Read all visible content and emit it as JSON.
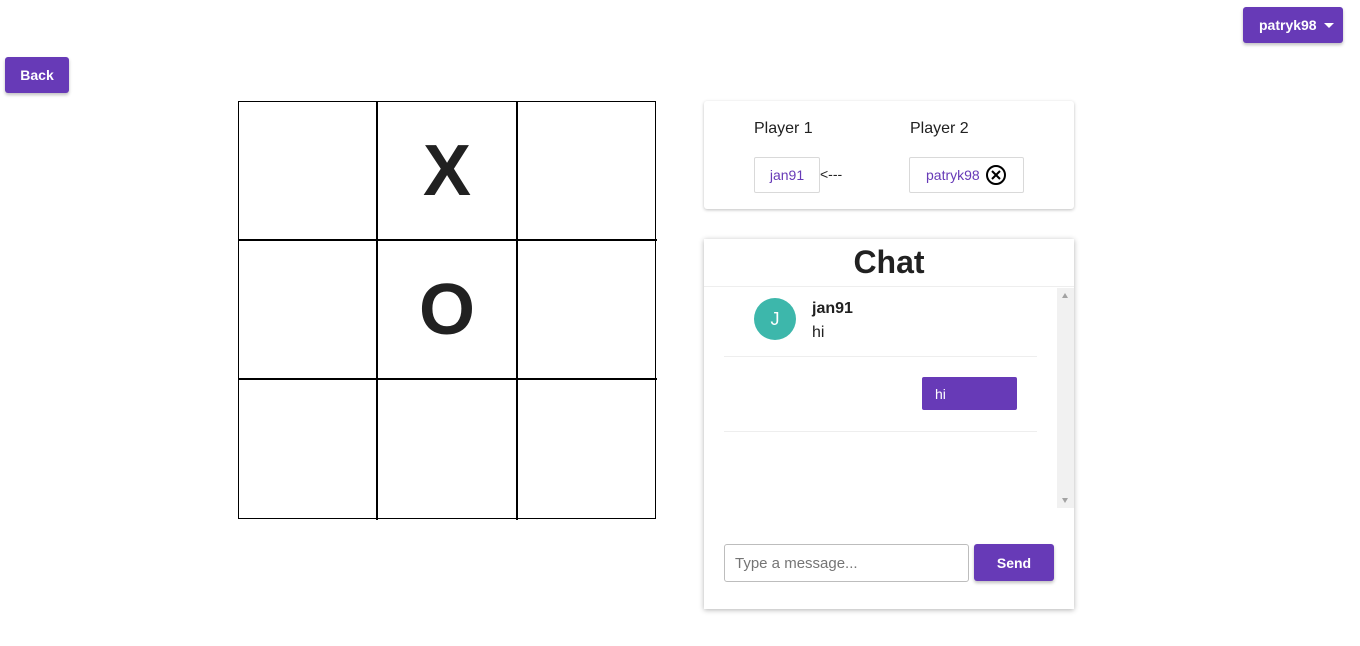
{
  "user_menu": {
    "username": "patryk98"
  },
  "nav": {
    "back_label": "Back"
  },
  "board": {
    "cells": [
      "",
      "X",
      "",
      "",
      "O",
      "",
      "",
      "",
      ""
    ]
  },
  "players": {
    "player1": {
      "label": "Player 1",
      "name": "jan91"
    },
    "player2": {
      "label": "Player 2",
      "name": "patryk98"
    },
    "turn_indicator": "<---"
  },
  "chat": {
    "title": "Chat",
    "messages": [
      {
        "avatar_initial": "J",
        "author": "jan91",
        "text": "hi"
      }
    ],
    "sent_messages": [
      {
        "text": "hi"
      }
    ],
    "input": {
      "placeholder": "Type a message...",
      "value": ""
    },
    "send_label": "Send"
  },
  "colors": {
    "accent": "#673ab7",
    "avatar": "#3db7ab",
    "text": "#212121"
  }
}
